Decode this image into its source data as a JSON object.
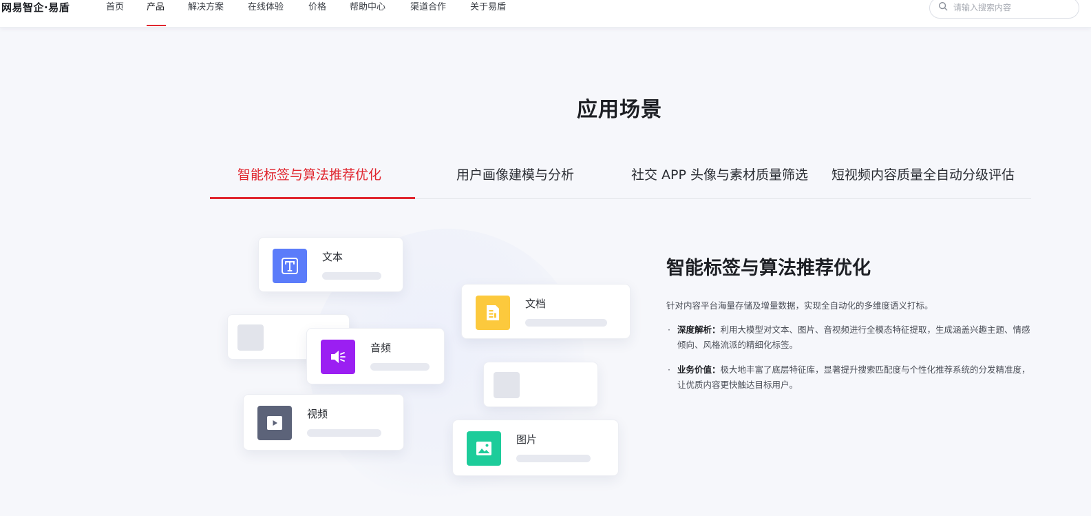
{
  "brand": {
    "logo": "网易智企·易盾"
  },
  "nav": {
    "items": [
      "首页",
      "产品",
      "解决方案",
      "在线体验",
      "价格",
      "帮助中心",
      "渠道合作",
      "关于易盾"
    ],
    "active_index": 1
  },
  "search": {
    "placeholder": "请输入搜索内容",
    "value": ""
  },
  "section": {
    "title": "应用场景"
  },
  "tabs": {
    "items": [
      "智能标签与算法推荐优化",
      "用户画像建模与分析",
      "社交 APP 头像与素材质量筛选",
      "短视频内容质量全自动分级评估"
    ],
    "active_index": 0
  },
  "illustration": {
    "cards": [
      {
        "label": "文本",
        "icon": "text-icon",
        "color": "#5b7cfa"
      },
      {
        "label": "文档",
        "icon": "document-icon",
        "color": "#fcc93d"
      },
      {
        "label": "音频",
        "icon": "audio-icon",
        "color": "#9b1ff2"
      },
      {
        "label": "视频",
        "icon": "video-icon",
        "color": "#5c6379"
      },
      {
        "label": "图片",
        "icon": "image-icon",
        "color": "#1dcc9a"
      }
    ]
  },
  "detail": {
    "title": "智能标签与算法推荐优化",
    "intro": "针对内容平台海量存储及增量数据，实现全自动化的多维度语义打标。",
    "points": [
      {
        "key": "深度解析：",
        "text": "利用大模型对文本、图片、音视频进行全模态特征提取，生成涵盖兴趣主题、情感倾向、风格流派的精细化标签。"
      },
      {
        "key": "业务价值：",
        "text": "极大地丰富了底层特征库，显著提升搜索匹配度与个性化推荐系统的分发精准度，让优质内容更快触达目标用户。"
      }
    ]
  },
  "colors": {
    "accent": "#e0262f",
    "background": "#f6f7fb"
  }
}
